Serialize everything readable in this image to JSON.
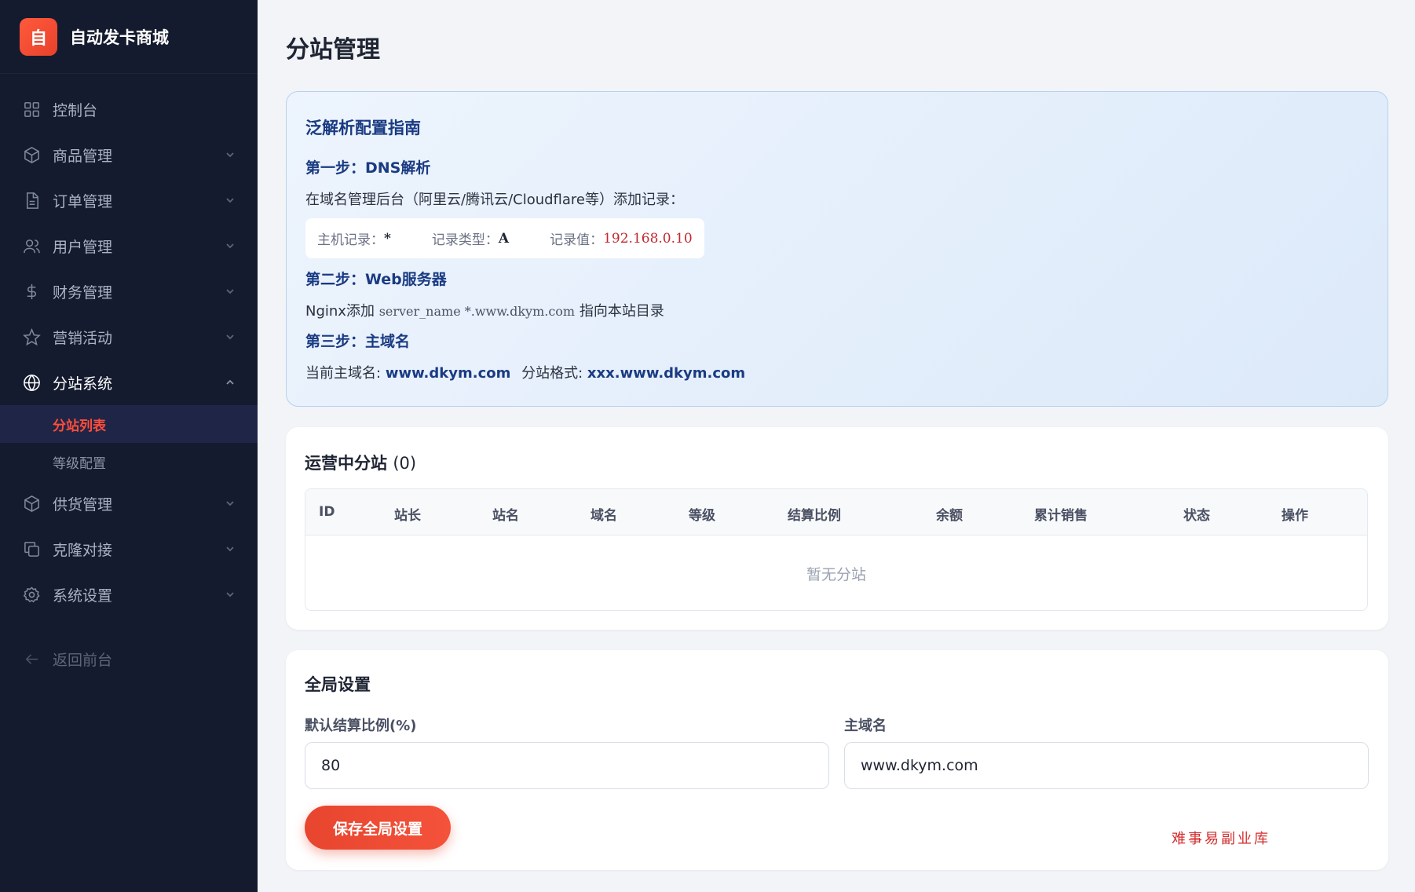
{
  "brand": {
    "logo_char": "自",
    "name": "自动发卡商城"
  },
  "sidebar": {
    "items": [
      {
        "label": "控制台",
        "icon": "grid-icon",
        "has_chevron": false
      },
      {
        "label": "商品管理",
        "icon": "box-icon",
        "has_chevron": true
      },
      {
        "label": "订单管理",
        "icon": "document-icon",
        "has_chevron": true
      },
      {
        "label": "用户管理",
        "icon": "users-icon",
        "has_chevron": true
      },
      {
        "label": "财务管理",
        "icon": "dollar-icon",
        "has_chevron": true
      },
      {
        "label": "营销活动",
        "icon": "star-icon",
        "has_chevron": true
      },
      {
        "label": "分站系统",
        "icon": "globe-icon",
        "has_chevron": true,
        "expanded": true
      }
    ],
    "sub_items": [
      {
        "label": "分站列表",
        "active": true
      },
      {
        "label": "等级配置",
        "active": false
      }
    ],
    "items_after": [
      {
        "label": "供货管理",
        "icon": "box-icon"
      },
      {
        "label": "克隆对接",
        "icon": "copy-icon"
      },
      {
        "label": "系统设置",
        "icon": "gear-icon"
      }
    ],
    "back_label": "返回前台"
  },
  "page": {
    "title": "分站管理"
  },
  "guide": {
    "title": "泛解析配置指南",
    "step1_title": "第一步：DNS解析",
    "step1_text": "在域名管理后台（阿里云/腾讯云/Cloudflare等）添加记录：",
    "record_host_label": "主机记录：",
    "record_host_value": "*",
    "record_type_label": "记录类型：",
    "record_type_value": "A",
    "record_value_label": "记录值：",
    "record_value_value": "192.168.0.10",
    "step2_title": "第二步：Web服务器",
    "step2_prefix": "Nginx添加",
    "step2_code": "server_name *.www.dkym.com",
    "step2_suffix": "指向本站目录",
    "step3_title": "第三步：主域名",
    "step3_main_label": "当前主域名:",
    "step3_main_value": "www.dkym.com",
    "step3_format_label": "分站格式:",
    "step3_format_value": "xxx.www.dkym.com"
  },
  "sites": {
    "title": "运营中分站",
    "count": "(0)",
    "columns": [
      "ID",
      "站长",
      "站名",
      "域名",
      "等级",
      "结算比例",
      "余额",
      "累计销售",
      "状态",
      "操作"
    ],
    "empty_text": "暂无分站"
  },
  "global": {
    "title": "全局设置",
    "ratio_label": "默认结算比例(%)",
    "ratio_value": "80",
    "domain_label": "主域名",
    "domain_value": "www.dkym.com",
    "save_label": "保存全局设置"
  },
  "watermark": "难事易副业库",
  "colors": {
    "sidebar_bg": "#151b2e",
    "accent": "#e8452e",
    "guide_text": "#1a3b82",
    "record_value": "#c4262e"
  }
}
